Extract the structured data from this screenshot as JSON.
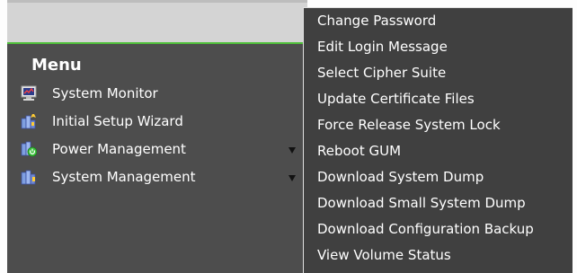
{
  "menu": {
    "heading": "Menu",
    "items": [
      {
        "label": "System Monitor",
        "icon": "monitor-icon",
        "has_submenu": false
      },
      {
        "label": "Initial Setup Wizard",
        "icon": "setup-wizard-icon",
        "has_submenu": false
      },
      {
        "label": "Power Management",
        "icon": "power-management-icon",
        "has_submenu": true
      },
      {
        "label": "System Management",
        "icon": "system-management-icon",
        "has_submenu": true
      }
    ]
  },
  "submenu": {
    "parent": "System Management",
    "items": [
      {
        "label": "Change Password"
      },
      {
        "label": "Edit Login Message"
      },
      {
        "label": "Select Cipher Suite"
      },
      {
        "label": "Update Certificate Files"
      },
      {
        "label": "Force Release System Lock"
      },
      {
        "label": "Reboot GUM"
      },
      {
        "label": "Download System Dump"
      },
      {
        "label": "Download Small System Dump"
      },
      {
        "label": "Download Configuration Backup"
      },
      {
        "label": "View Volume Status"
      }
    ]
  },
  "colors": {
    "panel_bg": "#4d4d4d",
    "submenu_bg": "#404040",
    "accent_green": "#4fbf3a",
    "text": "#ffffff"
  }
}
